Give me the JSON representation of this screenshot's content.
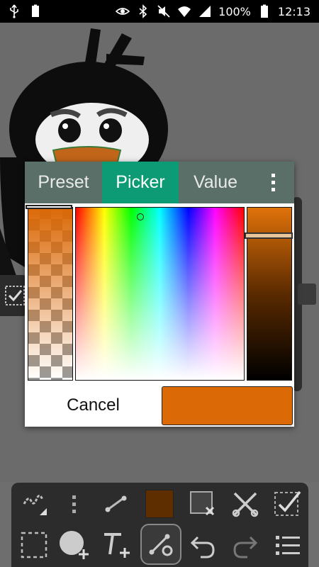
{
  "status_bar": {
    "left_icons": [
      "usb-icon",
      "battery-full-icon"
    ],
    "right_icons": [
      "eye-icon",
      "bluetooth-icon",
      "mute-icon",
      "wifi-icon",
      "signal-icon",
      "battery-icon"
    ],
    "battery_percent": "100%",
    "time": "12:13"
  },
  "dialog": {
    "tabs": [
      {
        "label": "Preset",
        "selected": false
      },
      {
        "label": "Picker",
        "selected": true
      },
      {
        "label": "Value",
        "selected": false
      }
    ],
    "more_icon": "overflow-menu-icon",
    "cancel_label": "Cancel",
    "selected_color": "#db6a06",
    "tab_bar_color": "#5a6f68",
    "active_tab_color": "#0c9b74"
  },
  "toolbar": {
    "current_color": "#5e2e00",
    "icons_row1": [
      "pen-pressure-icon",
      "more-vert-icon",
      "line-tool-icon",
      "color-swatch",
      "clear-selection-icon",
      "cut-icon",
      "select-all-icon"
    ],
    "icons_row2": [
      "rectangle-select-icon",
      "add-layer-icon",
      "add-text-icon",
      "vector-settings-icon",
      "undo-icon",
      "redo-icon",
      "menu-icon"
    ]
  }
}
